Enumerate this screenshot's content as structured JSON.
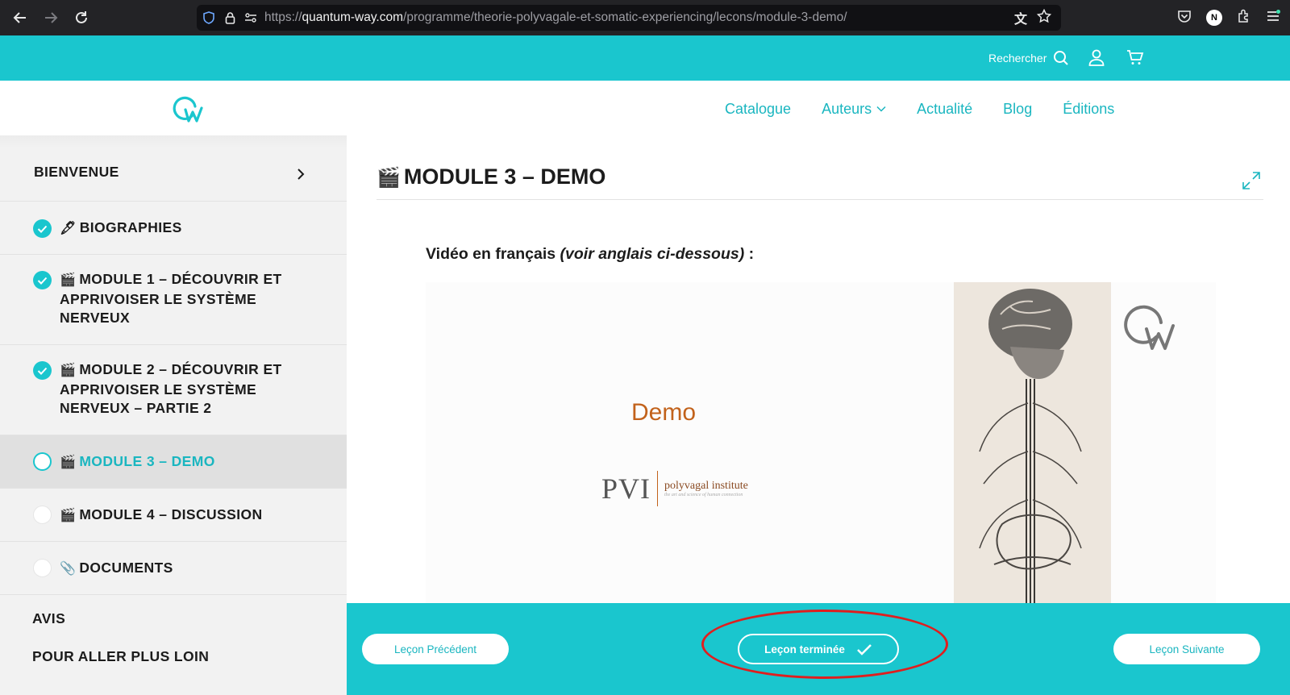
{
  "browser": {
    "url_prefix": "https://",
    "url_host": "quantum-way.com",
    "url_path": "/programme/theorie-polyvagale-et-somatic-experiencing/lecons/module-3-demo/",
    "profile_initial": "N"
  },
  "topbar": {
    "search_label": "Rechercher"
  },
  "nav": {
    "items": [
      {
        "label": "Catalogue"
      },
      {
        "label": "Auteurs",
        "has_dropdown": true
      },
      {
        "label": "Actualité"
      },
      {
        "label": "Blog"
      },
      {
        "label": "Éditions"
      }
    ]
  },
  "sidebar": {
    "items": [
      {
        "label": "BIENVENUE",
        "status": "none"
      },
      {
        "emoji": "🖋",
        "label": "BIOGRAPHIES",
        "status": "done"
      },
      {
        "emoji": "🎬",
        "line1": "MODULE 1 – DÉCOUVRIR ET",
        "line2": "APPRIVOISER LE SYSTÈME",
        "line3": "NERVEUX",
        "status": "done"
      },
      {
        "emoji": "🎬",
        "line1": "MODULE 2 – DÉCOUVRIR ET",
        "line2": "APPRIVOISER LE SYSTÈME",
        "line3": "NERVEUX – PARTIE 2",
        "status": "done"
      },
      {
        "emoji": "🎬",
        "label": "MODULE 3 – DEMO",
        "status": "current"
      },
      {
        "emoji": "🎬",
        "label": "MODULE 4 – DISCUSSION",
        "status": "todo"
      },
      {
        "emoji": "📎",
        "label": "DOCUMENTS",
        "status": "todo"
      }
    ],
    "footer_links": [
      {
        "label": "AVIS"
      },
      {
        "label": "POUR ALLER PLUS LOIN"
      }
    ]
  },
  "lesson": {
    "emoji": "🎬",
    "title": "MODULE 3 – DEMO",
    "intro_plain": "Vidéo en français ",
    "intro_italic": "(voir anglais ci-dessous)",
    "intro_end": " :",
    "video": {
      "demo_text": "Demo",
      "pvi_abbr": "PVI",
      "pvi_name": "polyvagal institute",
      "pvi_tagline": "the art and science of human connection"
    }
  },
  "footer_nav": {
    "prev_label": "Leçon Précédent",
    "complete_label": "Leçon terminée",
    "next_label": "Leçon Suivante"
  },
  "colors": {
    "accent": "#1ac6ce",
    "accent_text": "#1ab6c0",
    "annotation": "#e01e1e",
    "demo_orange": "#c2621b"
  }
}
